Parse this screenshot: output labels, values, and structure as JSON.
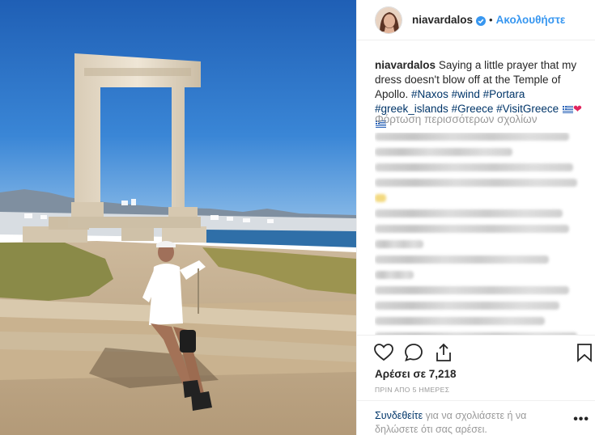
{
  "post": {
    "header": {
      "username": "niavardalos",
      "separator": "•",
      "follow_label": "Ακολουθήστε"
    },
    "caption": {
      "username": "niavardalos",
      "text": "Saying a little prayer that my dress doesn't blow off at the Temple of Apollo.",
      "hashtags": [
        "#Naxos",
        "#wind",
        "#Portara",
        "#greek_islands",
        "#Greece",
        "#VisitGreece"
      ]
    },
    "load_more_label": "Φόρτωση περισσότερων σχολίων",
    "likes_label": "Αρέσει σε 7,218",
    "timestamp": "ΠΡΙΝ ΑΠΟ 5 ΗΜΕΡΕΣ",
    "footer": {
      "login_link": "Συνδεθείτε",
      "login_rest": "για να σχολιάσετε ή να δηλώσετε ότι σας αρέσει.",
      "options_label": "•••"
    }
  },
  "colors": {
    "link_blue": "#3897f0",
    "hashtag": "#003569",
    "muted": "#999999",
    "sky": "#2c6fc0"
  },
  "icons": {
    "verified": "verified-badge-icon",
    "like": "heart-outline-icon",
    "comment": "comment-bubble-icon",
    "share": "share-upload-icon",
    "save": "bookmark-icon",
    "flag": "greek-flag-icon"
  }
}
